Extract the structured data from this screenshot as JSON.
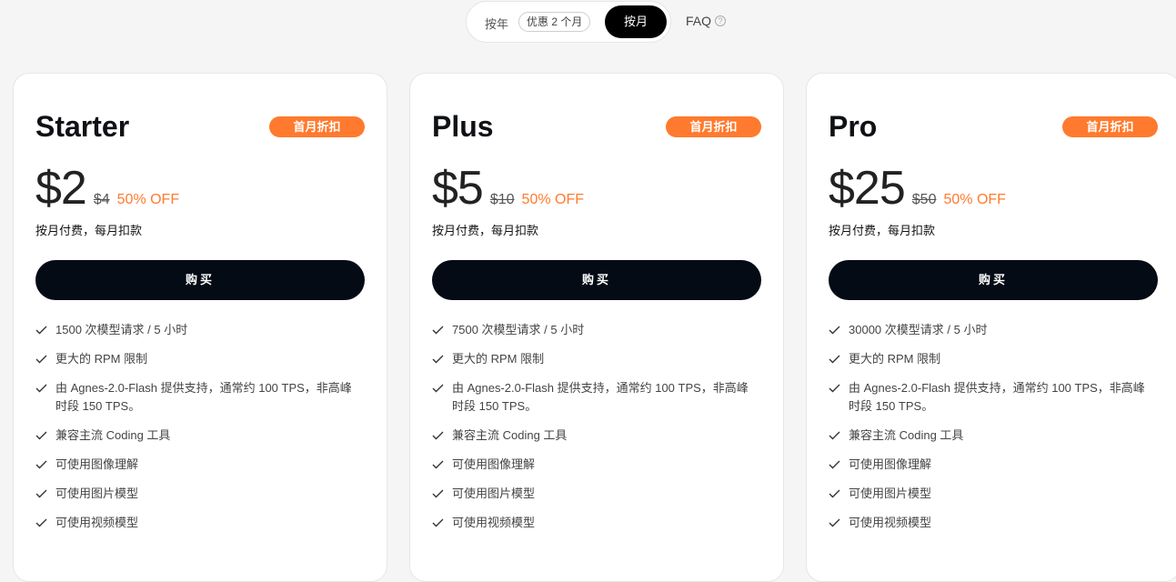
{
  "billing_toggle": {
    "yearly_label": "按年",
    "yearly_badge": "优惠 2 个月",
    "monthly_label": "按月",
    "faq_label": "FAQ"
  },
  "plans": [
    {
      "name": "Starter",
      "badge": "首月折扣",
      "price": "$2",
      "old_price": "$4",
      "discount": "50% OFF",
      "billing_note": "按月付费，每月扣款",
      "buy_label": "购买",
      "features": [
        "1500 次模型请求 / 5 小时",
        "更大的 RPM 限制",
        "由 Agnes-2.0-Flash 提供支持，通常约 100 TPS，非高峰时段 150 TPS。",
        "兼容主流 Coding 工具",
        "可使用图像理解",
        "可使用图片模型",
        "可使用视频模型"
      ]
    },
    {
      "name": "Plus",
      "badge": "首月折扣",
      "price": "$5",
      "old_price": "$10",
      "discount": "50% OFF",
      "billing_note": "按月付费，每月扣款",
      "buy_label": "购买",
      "features": [
        "7500 次模型请求 / 5 小时",
        "更大的 RPM 限制",
        "由 Agnes-2.0-Flash 提供支持，通常约 100 TPS，非高峰时段 150 TPS。",
        "兼容主流 Coding 工具",
        "可使用图像理解",
        "可使用图片模型",
        "可使用视频模型"
      ]
    },
    {
      "name": "Pro",
      "badge": "首月折扣",
      "price": "$25",
      "old_price": "$50",
      "discount": "50% OFF",
      "billing_note": "按月付费，每月扣款",
      "buy_label": "购买",
      "features": [
        "30000 次模型请求 / 5 小时",
        "更大的 RPM 限制",
        "由 Agnes-2.0-Flash 提供支持，通常约 100 TPS，非高峰时段 150 TPS。",
        "兼容主流 Coding 工具",
        "可使用图像理解",
        "可使用图片模型",
        "可使用视频模型"
      ]
    }
  ],
  "colors": {
    "accent": "#ff7a2e",
    "button_bg": "#050b14",
    "page_bg": "#f5f5f5"
  },
  "icons": {
    "feature_bullet": "check-icon",
    "faq": "question-circle-icon"
  }
}
